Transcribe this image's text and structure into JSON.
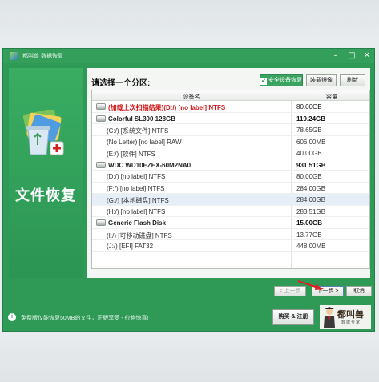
{
  "window": {
    "title": "都叫兽 数据恢复",
    "controls": {
      "minimize": "–",
      "maximize": "□",
      "close": "✕"
    }
  },
  "sidebar": {
    "app_name": "文件恢复",
    "icon": "recycle-bin-icon"
  },
  "panel": {
    "title": "请选择一个分区:",
    "buttons": {
      "safe_recovery": "安全设备恢复",
      "mount_image": "装载镜像",
      "refresh": "刷新"
    },
    "columns": {
      "device": "设备名",
      "capacity": "容量"
    }
  },
  "rows": [
    {
      "type": "red",
      "name": "(加载上次扫描结果)(D:/) [no label] NTFS",
      "capacity": "80.00GB"
    },
    {
      "type": "disk",
      "name": "Colorful SL300 128GB",
      "capacity": "119.24GB"
    },
    {
      "type": "part",
      "name": "(C:/) [系统文件] NTFS",
      "capacity": "78.65GB"
    },
    {
      "type": "part",
      "name": "(No Letter) [no label] RAW",
      "capacity": "606.00MB"
    },
    {
      "type": "part",
      "name": "(E:/) [软件] NTFS",
      "capacity": "40.00GB"
    },
    {
      "type": "disk",
      "name": "WDC WD10EZEX-60M2NA0",
      "capacity": "931.51GB"
    },
    {
      "type": "part",
      "name": "(D:/) [no label] NTFS",
      "capacity": "80.00GB"
    },
    {
      "type": "part",
      "name": "(F:/) [no label] NTFS",
      "capacity": "284.00GB"
    },
    {
      "type": "part sel",
      "name": "(G:/) [本地磁盘] NTFS",
      "capacity": "284.00GB"
    },
    {
      "type": "part",
      "name": "(H:/) [no label] NTFS",
      "capacity": "283.51GB"
    },
    {
      "type": "disk",
      "name": "Generic Flash Disk",
      "capacity": "15.00GB"
    },
    {
      "type": "part",
      "name": "(I:/) [可移动磁盘] NTFS",
      "capacity": "13.77GB"
    },
    {
      "type": "part",
      "name": "(J:/) [EFI] FAT32",
      "capacity": "448.00MB"
    }
  ],
  "footer_buttons": {
    "prev": "< 上一步",
    "next": "下一步 >",
    "cancel": "取消"
  },
  "bottom": {
    "notice": "免费版仅能恢复50MB的文件，正版享受 - 价格惊喜!",
    "buy_button": "购买 & 注册",
    "brand_name": "都叫兽",
    "brand_sub": "数据专家"
  },
  "colors": {
    "window_green": "#2f9a56",
    "highlight_red": "#d01818",
    "selected_row": "#e6eef8"
  }
}
